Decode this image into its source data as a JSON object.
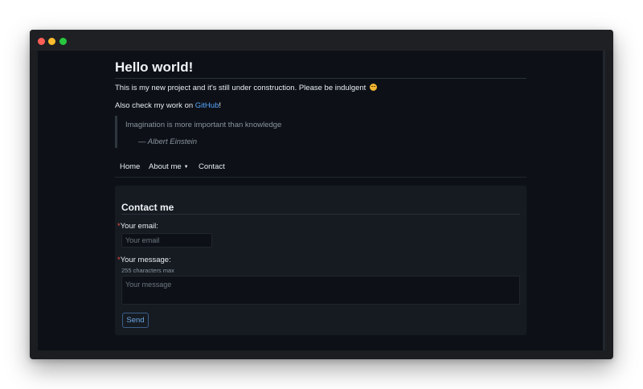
{
  "window": {
    "controls": [
      "close",
      "minimize",
      "maximize"
    ]
  },
  "page": {
    "title": "Hello world!",
    "intro": "This is my new project and it's still under construction. Please be indulgent",
    "intro_emoji": "smiling-face-icon",
    "also_prefix": "Also check my work on ",
    "github_link": "GitHub",
    "also_suffix": "!",
    "quote": {
      "text": "Imagination is more important than knowledge",
      "author": "— Albert Einstein"
    }
  },
  "nav": {
    "home": "Home",
    "about": "About me",
    "about_caret": "▼",
    "contact": "Contact"
  },
  "contact_form": {
    "heading": "Contact me",
    "required_mark": "*",
    "email_label": "Your email:",
    "email_placeholder": "Your email",
    "email_value": "",
    "message_label": "Your message:",
    "message_hint": "255 characters max",
    "message_placeholder": "Your message",
    "message_value": "",
    "send_label": "Send"
  },
  "colors": {
    "background": "#0d1117",
    "card": "#161b22",
    "link": "#58a6ff",
    "required": "#f85149",
    "button_border": "#3b5f8a"
  }
}
